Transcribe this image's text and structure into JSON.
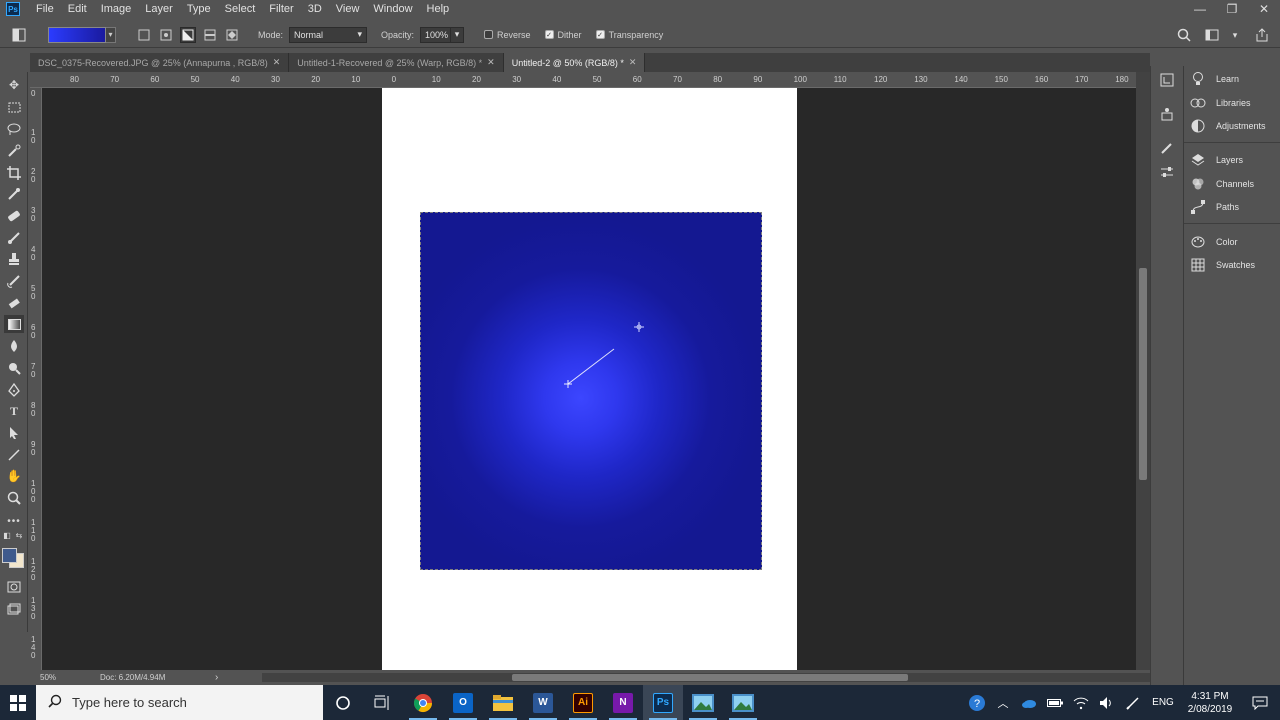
{
  "app": {
    "logo": "Ps"
  },
  "menu": [
    "File",
    "Edit",
    "Image",
    "Layer",
    "Type",
    "Select",
    "Filter",
    "3D",
    "View",
    "Window",
    "Help"
  ],
  "window_controls": {
    "minimize": "—",
    "restore": "❐",
    "close": "✕"
  },
  "options_bar": {
    "gradient_start_color": "#2b3cff",
    "gradient_end_color": "#1a1a9e",
    "mode_label": "Mode:",
    "mode_value": "Normal",
    "opacity_label": "Opacity:",
    "opacity_value": "100%",
    "reverse_label": "Reverse",
    "reverse_checked": false,
    "dither_label": "Dither",
    "dither_checked": true,
    "transparency_label": "Transparency",
    "transparency_checked": true
  },
  "tabs": [
    {
      "label": "DSC_0375-Recovered.JPG @ 25% (Annapurna , RGB/8)",
      "close": "✕",
      "active": false
    },
    {
      "label": "Untitled-1-Recovered @ 25% (Warp, RGB/8) *",
      "close": "✕",
      "active": false
    },
    {
      "label": "Untitled-2 @ 50% (RGB/8) *",
      "close": "✕",
      "active": true
    }
  ],
  "rulers": {
    "top_labels": [
      "80",
      "70",
      "60",
      "50",
      "40",
      "30",
      "20",
      "10",
      "0",
      "10",
      "20",
      "30",
      "40",
      "50",
      "60",
      "70",
      "80",
      "90",
      "100",
      "110",
      "120",
      "130",
      "140",
      "150",
      "160",
      "170",
      "180"
    ],
    "left_labels": [
      "0",
      "1\n0",
      "2\n0",
      "3\n0",
      "4\n0",
      "5\n0",
      "6\n0",
      "7\n0",
      "8\n0",
      "9\n0",
      "1\n0\n0",
      "1\n1\n0",
      "1\n2\n0",
      "1\n3\n0",
      "1\n4\n0"
    ]
  },
  "status": {
    "zoom": "50%",
    "doc_info": "Doc: 6.20M/4.94M",
    "arrow": "›"
  },
  "panels": [
    {
      "icon": "bulb-icon",
      "label": "Learn"
    },
    {
      "icon": "libraries-icon",
      "label": "Libraries"
    },
    {
      "icon": "adjustments-icon",
      "label": "Adjustments"
    },
    {
      "icon": "layers-icon",
      "label": "Layers"
    },
    {
      "icon": "channels-icon",
      "label": "Channels"
    },
    {
      "icon": "paths-icon",
      "label": "Paths"
    },
    {
      "icon": "color-icon",
      "label": "Color"
    },
    {
      "icon": "swatches-icon",
      "label": "Swatches"
    }
  ],
  "colors": {
    "foreground": "#3f5a8c",
    "background": "#f2e6cc",
    "gradient_center": "#3c46ff",
    "gradient_edge": "#141891"
  },
  "taskbar": {
    "search_placeholder": "Type here to search",
    "apps": [
      "Chrome",
      "Outlook",
      "File Explorer",
      "Word",
      "Illustrator",
      "OneNote",
      "Photoshop",
      "Photos",
      "Photos"
    ],
    "tray_lang": "ENG",
    "time": "4:31 PM",
    "date": "2/08/2019"
  }
}
